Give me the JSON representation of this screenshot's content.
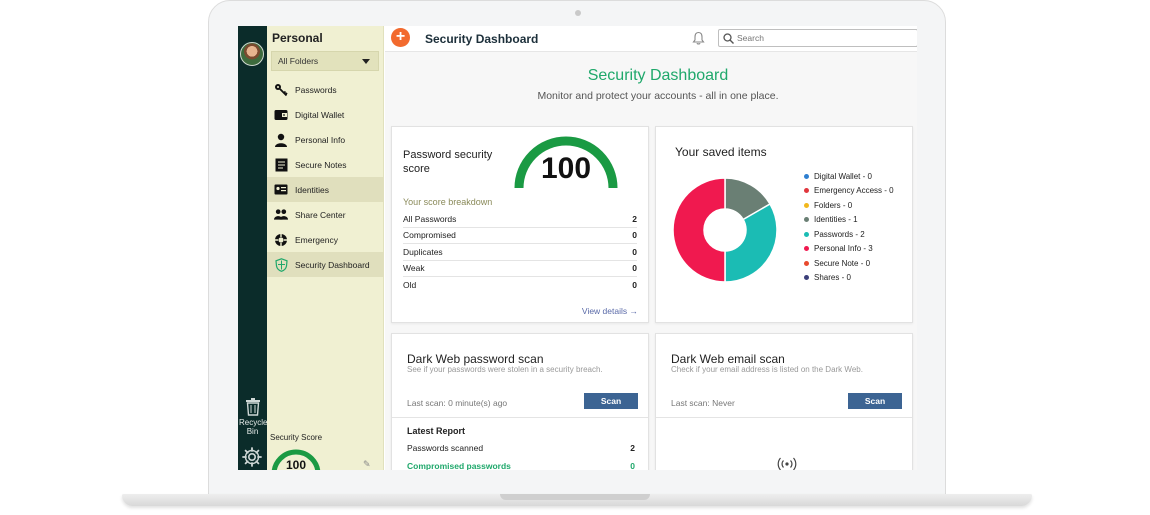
{
  "colors": {
    "accent": "#1fa86b",
    "rail": "#0b2c2a",
    "sidebar": "#f0f0d2",
    "primary_button": "#3c6493",
    "add_button": "#f26a2e",
    "gauge": "#1a9a43"
  },
  "sidebar": {
    "title": "Personal",
    "folder_select": "All Folders",
    "items": [
      {
        "label": "Passwords",
        "icon": "key-icon"
      },
      {
        "label": "Digital Wallet",
        "icon": "wallet-icon"
      },
      {
        "label": "Personal Info",
        "icon": "person-icon"
      },
      {
        "label": "Secure Notes",
        "icon": "note-icon"
      },
      {
        "label": "Identities",
        "icon": "id-card-icon",
        "active": true
      },
      {
        "label": "Share Center",
        "icon": "share-people-icon"
      },
      {
        "label": "Emergency",
        "icon": "lifebuoy-icon"
      },
      {
        "label": "Security Dashboard",
        "icon": "shield-icon",
        "active": true
      }
    ],
    "recycle_label": "Recycle Bin",
    "score_label": "Security Score",
    "score_value": "100"
  },
  "topbar": {
    "title": "Security Dashboard",
    "search_placeholder": "Search"
  },
  "main": {
    "title": "Security Dashboard",
    "subtitle": "Monitor and protect your accounts - all in one place.",
    "password_card": {
      "title": "Password security score",
      "score": "100",
      "score_fraction": 1.0,
      "breakdown_label": "Your score breakdown",
      "rows": [
        {
          "label": "All Passwords",
          "value": "2"
        },
        {
          "label": "Compromised",
          "value": "0"
        },
        {
          "label": "Duplicates",
          "value": "0"
        },
        {
          "label": "Weak",
          "value": "0"
        },
        {
          "label": "Old",
          "value": "0"
        }
      ],
      "view_details": "View details →"
    },
    "saved_items": {
      "title": "Your saved items",
      "legend": [
        {
          "label": "Digital Wallet - 0",
          "color": "#2e7fd0"
        },
        {
          "label": "Emergency Access - 0",
          "color": "#e0363d"
        },
        {
          "label": "Folders - 0",
          "color": "#f2b81d"
        },
        {
          "label": "Identities - 1",
          "color": "#6a7f74"
        },
        {
          "label": "Passwords - 2",
          "color": "#1bbcb4"
        },
        {
          "label": "Personal Info - 3",
          "color": "#f0194f"
        },
        {
          "label": "Secure Note - 0",
          "color": "#e84a2e"
        },
        {
          "label": "Shares - 0",
          "color": "#3b3f7a"
        }
      ]
    },
    "dark_web_password": {
      "title": "Dark Web password scan",
      "subtitle": "See if your passwords were stolen in a security breach.",
      "last_scan": "Last scan: 0 minute(s) ago",
      "button": "Scan",
      "report_title": "Latest Report",
      "rows": [
        {
          "label": "Passwords scanned",
          "value": "2"
        },
        {
          "label": "Compromised passwords",
          "value": "0"
        }
      ]
    },
    "dark_web_email": {
      "title": "Dark Web email scan",
      "subtitle": "Check if your email address is listed on the Dark Web.",
      "last_scan": "Last scan: Never",
      "button": "Scan"
    }
  },
  "chart_data": {
    "type": "pie",
    "title": "Your saved items",
    "categories": [
      "Digital Wallet",
      "Emergency Access",
      "Folders",
      "Identities",
      "Passwords",
      "Personal Info",
      "Secure Note",
      "Shares"
    ],
    "values": [
      0,
      0,
      0,
      1,
      2,
      3,
      0,
      0
    ],
    "colors": [
      "#2e7fd0",
      "#e0363d",
      "#f2b81d",
      "#6a7f74",
      "#1bbcb4",
      "#f0194f",
      "#e84a2e",
      "#3b3f7a"
    ],
    "donut": true,
    "legend": "right"
  }
}
